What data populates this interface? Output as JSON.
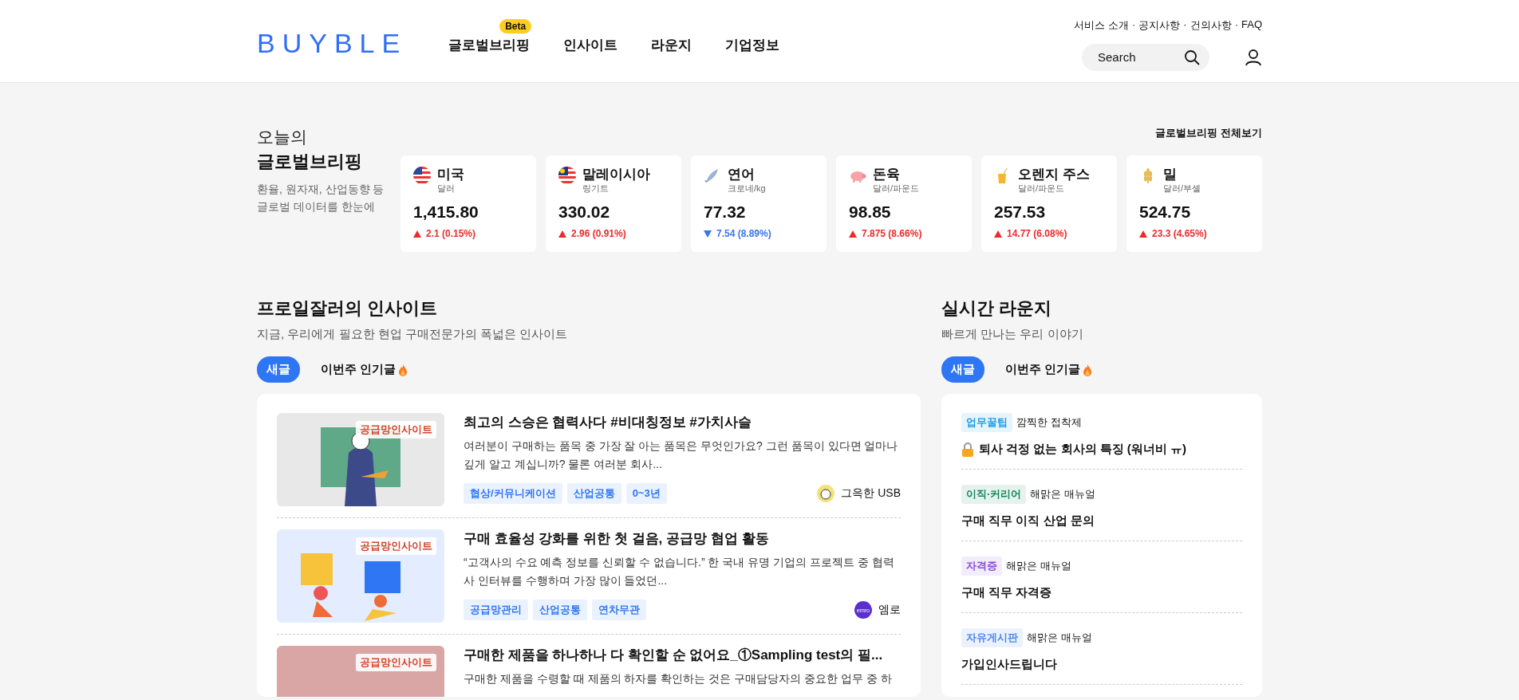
{
  "header": {
    "logo": "BUYBLE",
    "nav": [
      {
        "label": "글로벌브리핑",
        "badge": "Beta"
      },
      {
        "label": "인사이트"
      },
      {
        "label": "라운지"
      },
      {
        "label": "기업정보"
      }
    ],
    "top_links": [
      "서비스 소개",
      "공지사항",
      "건의사항",
      "FAQ"
    ],
    "link_separator": "·",
    "search": {
      "placeholder": "Search"
    }
  },
  "briefing": {
    "kicker": "오늘의",
    "title": "글로벌브리핑",
    "description": "환율, 원자재, 산업동향 등 글로벌 데이터를 한눈에",
    "view_all": "글로벌브리핑 전체보기",
    "cards": [
      {
        "kind": "us-flag",
        "name": "미국",
        "unit": "달러",
        "value": "1,415.80",
        "rising": true,
        "change": "2.1 (0.15%)"
      },
      {
        "kind": "my-flag",
        "name": "말레이시아",
        "unit": "링기트",
        "value": "330.02",
        "rising": true,
        "change": "2.96 (0.91%)"
      },
      {
        "kind": "fish",
        "name": "연어",
        "unit": "크로네/kg",
        "value": "77.32",
        "rising": false,
        "change": "7.54 (8.89%)"
      },
      {
        "kind": "pig",
        "name": "돈육",
        "unit": "달러/파운드",
        "value": "98.85",
        "rising": true,
        "change": "7.875 (8.66%)"
      },
      {
        "kind": "juice",
        "name": "오렌지 주스",
        "unit": "달러/파운드",
        "value": "257.53",
        "rising": true,
        "change": "14.77 (6.08%)"
      },
      {
        "kind": "wheat",
        "name": "밀",
        "unit": "달러/부셸",
        "value": "524.75",
        "rising": true,
        "change": "23.3 (4.65%)"
      }
    ]
  },
  "insights": {
    "title": "프로일잘러의 인사이트",
    "subtitle": "지금, 우리에게 필요한 현업 구매전문가의 폭넓은 인사이트",
    "tabs": [
      {
        "label": "새글",
        "selected": true,
        "hot": false
      },
      {
        "label": "이번주 인기글",
        "selected": false,
        "hot": true
      }
    ],
    "posts": [
      {
        "kind": "teacher",
        "badge": "공급망인사이트",
        "title": "최고의 스승은 협력사다 #비대칭정보 #가치사슬",
        "excerpt": "여러분이 구매하는 품목 중 가장 잘 아는 품목은 무엇인가요? 그런 품목이 있다면 얼마나 깊게 알고 계십니까? 물론 여러분 회사...",
        "tags": [
          "협상/커뮤니케이션",
          "산업공통",
          "0~3년"
        ],
        "author": {
          "name": "그윽한 USB",
          "kind": "avatar"
        }
      },
      {
        "kind": "puzzle",
        "badge": "공급망인사이트",
        "title": "구매 효율성 강화를 위한 첫 걸음, 공급망 협업 활동",
        "excerpt": "“고객사의 수요 예측 정보를 신뢰할 수 없습니다.” 한 국내 유명 기업의 프로젝트 중 협력사 인터뷰를 수행하며 가장 많이 들었던...",
        "tags": [
          "공급망관리",
          "산업공통",
          "연차무관"
        ],
        "author": {
          "name": "엠로",
          "kind": "logo",
          "logo_text": "emro"
        }
      },
      {
        "kind": "lab",
        "badge": "공급망인사이트",
        "title": "구매한 제품을 하나하나 다 확인할 순 없어요_①Sampling test의 필...",
        "excerpt": "구매한 제품을 수령할 때 제품의 하자를 확인하는 것은 구매담당자의 중요한 업무 중 하"
      }
    ]
  },
  "lounge": {
    "title": "실시간 라운지",
    "subtitle": "빠르게 만나는 우리 이야기",
    "tabs": [
      {
        "label": "새글",
        "selected": true,
        "hot": false
      },
      {
        "label": "이번주 인기글",
        "selected": false,
        "hot": true
      }
    ],
    "posts": [
      {
        "tag": "업무꿀팁",
        "color": "#1a9be6",
        "author": "깜찍한 접착제",
        "title": "퇴사 걱정 없는 회사의 특징 (워너비 ㅠ)",
        "locked": true
      },
      {
        "tag": "이직·커리어",
        "color": "#14885a",
        "author": "해맑은 매뉴얼",
        "title": "구매 직무 이직 산업 문의",
        "locked": false
      },
      {
        "tag": "자격증",
        "color": "#8a4fe0",
        "author": "해맑은 매뉴얼",
        "title": "구매 직무 자격증",
        "locked": false
      },
      {
        "tag": "자유게시판",
        "color": "#4a86f0",
        "author": "해맑은 매뉴얼",
        "title": "가입인사드립니다",
        "locked": false
      }
    ]
  }
}
